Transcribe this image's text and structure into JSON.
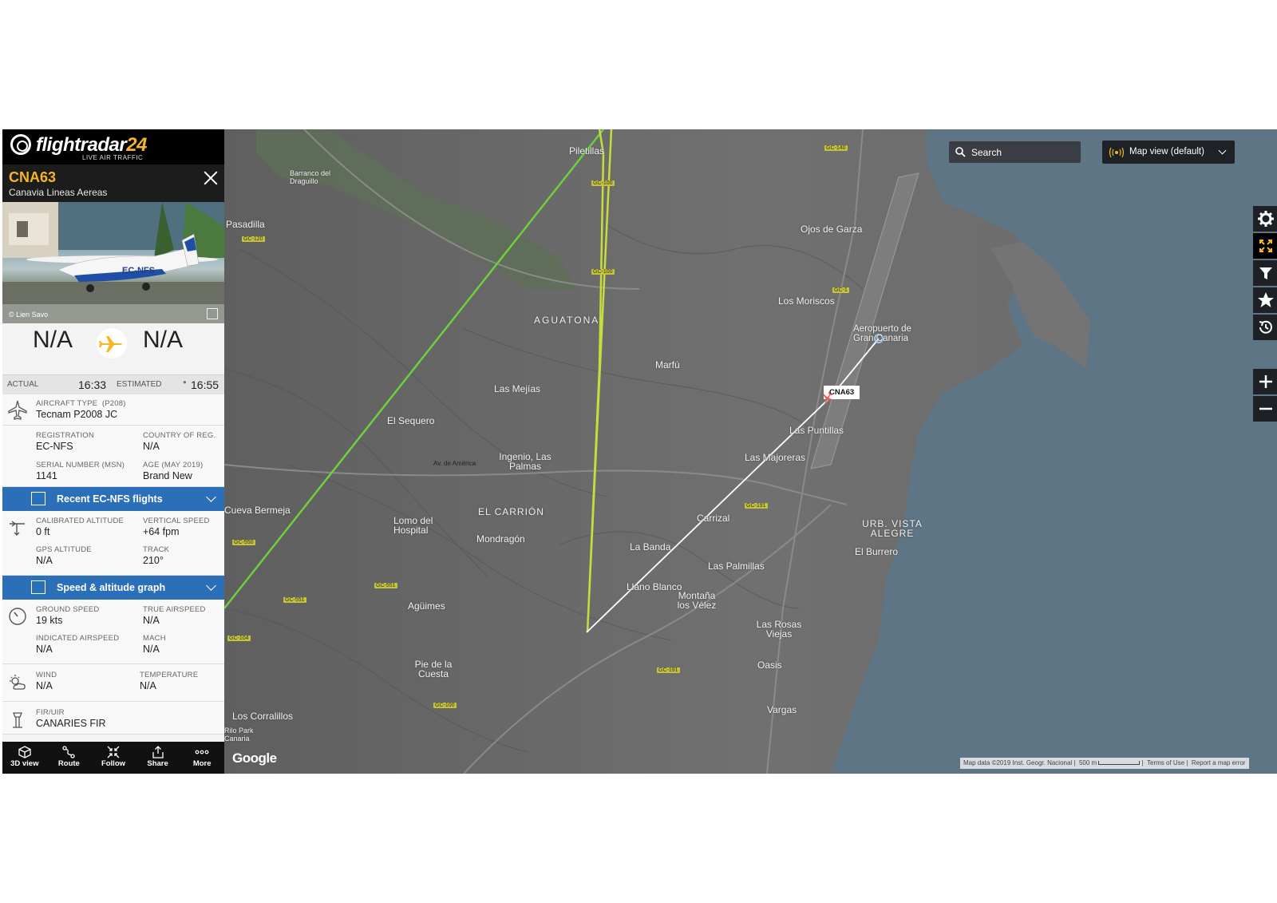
{
  "header": {
    "brand": "flightradar24",
    "brand_main": "flightradar",
    "brand_num": "24",
    "brand_sub": "LIVE AIR TRAFFIC"
  },
  "flight": {
    "callsign": "CNA63",
    "airline": "Canavia Lineas Aereas",
    "photo_credit": "© Lien Savo",
    "aircraft_reg_on_photo": "EC-NFS",
    "origin": "N/A",
    "destination": "N/A",
    "actual_label": "ACTUAL",
    "actual_time": "16:33",
    "estimated_label": "ESTIMATED",
    "estimated_time": "16:55"
  },
  "aircraft": {
    "type_label": "AIRCRAFT TYPE",
    "type_code": "(P208)",
    "type_value": "Tecnam P2008 JC",
    "reg_label": "REGISTRATION",
    "reg_value": "EC-NFS",
    "country_label": "COUNTRY OF REG.",
    "country_value": "N/A",
    "serial_label": "SERIAL NUMBER (MSN)",
    "serial_value": "1141",
    "age_label": "AGE (MAY 2019)",
    "age_value": "Brand New"
  },
  "recent_flights_label": "Recent EC-NFS flights",
  "altitude": {
    "cal_alt_label": "CALIBRATED ALTITUDE",
    "cal_alt_value": "0 ft",
    "vspeed_label": "VERTICAL SPEED",
    "vspeed_value": "+64 fpm",
    "gps_alt_label": "GPS ALTITUDE",
    "gps_alt_value": "N/A",
    "track_label": "TRACK",
    "track_value": "210°"
  },
  "graph_label": "Speed & altitude graph",
  "speed": {
    "gs_label": "GROUND SPEED",
    "gs_value": "19 kts",
    "tas_label": "TRUE AIRSPEED",
    "tas_value": "N/A",
    "ias_label": "INDICATED AIRSPEED",
    "ias_value": "N/A",
    "mach_label": "MACH",
    "mach_value": "N/A"
  },
  "weather": {
    "wind_label": "WIND",
    "wind_value": "N/A",
    "temp_label": "TEMPERATURE",
    "temp_value": "N/A"
  },
  "fir": {
    "label": "FIR/UIR",
    "value": "CANARIES FIR"
  },
  "bottom_bar": [
    "3D view",
    "Route",
    "Follow",
    "Share",
    "More"
  ],
  "map": {
    "search_label": "Search",
    "view_label": "Map view (default)",
    "callsign_tag": "CNA63",
    "google": "Google",
    "attribution": "Map data ©2019 Inst. Geogr. Nacional",
    "scale": "500 m",
    "terms": "Terms of Use",
    "report": "Report a map error",
    "places": [
      "Piletillas",
      "Barranco del Draguillo",
      "Pasadilla",
      "Ojos de Garza",
      "Los Moriscos",
      "AGUATONA",
      "Aeropuerto de Gran Canaria",
      "Marfú",
      "Las Mejías",
      "El Sequero",
      "Las Puntillas",
      "Av. de América",
      "Ingenio, Las Palmas",
      "Las Majoreras",
      "Cueva Bermeja",
      "EL CARRIÓN",
      "Lomo del Hospital",
      "Carrizal",
      "URB. VISTA ALEGRE",
      "Mondragón",
      "La Banda",
      "El Burrero",
      "Las Palmillas",
      "Llano Blanco",
      "Montaña los Vélez",
      "Agüimes",
      "Las Rosas Viejas",
      "Pie de la Cuesta",
      "Oasis",
      "Los Corralillos",
      "Vargas",
      "Rilo Park Canaria"
    ],
    "roads": [
      "GC-140",
      "GC-100",
      "GC-120",
      "GC-1",
      "GC-191",
      "GC-550",
      "GC-551",
      "GC-104",
      "GC-551",
      "GC-100",
      "GC-191",
      "GC-100"
    ]
  },
  "colors": {
    "brand_yellow": "#f5b622",
    "panel_blue": "#2a6fb7",
    "sea": "#5d7585",
    "trail_green": "#6cd13a",
    "trail_yellow": "#c8dc3c",
    "trail_white": "#ffffff"
  }
}
